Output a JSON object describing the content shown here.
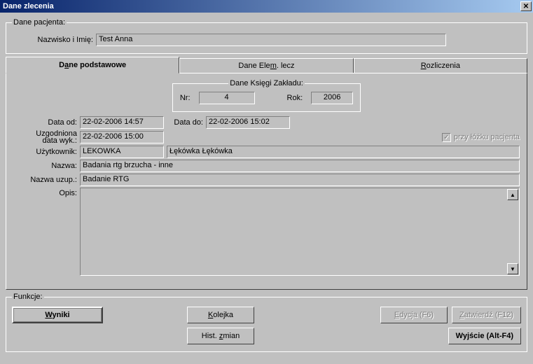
{
  "window": {
    "title": "Dane zlecenia"
  },
  "patient": {
    "legend": "Dane pacjenta:",
    "name_label": "Nazwisko i Imię:",
    "name_value": "Test   Anna"
  },
  "tabs": {
    "basic_pre": "D",
    "basic_ul": "a",
    "basic_post": "ne podstawowe",
    "elem_pre": "Dane Ele",
    "elem_ul": "m",
    "elem_post": ". lecz",
    "rozl_pre": "",
    "rozl_ul": "R",
    "rozl_post": "ozliczenia"
  },
  "ksiega": {
    "legend": "Dane Księgi Zakładu:",
    "nr_label": "Nr:",
    "nr_value": "4",
    "rok_label": "Rok:",
    "rok_value": "2006"
  },
  "fields": {
    "data_od_label": "Data od:",
    "data_od_value": "22-02-2006 14:57",
    "data_do_label": "Data do:",
    "data_do_value": "22-02-2006 15:02",
    "uzg_label_1": "Uzgodniona",
    "uzg_label_2": "data wyk.:",
    "uzg_value": "22-02-2006 15:00",
    "przy_lozku_label": "przy łóżku pacjenta",
    "uzytkownik_label": "Użytkownik:",
    "uzytkownik_code": "LEKOWKA",
    "uzytkownik_name": "Łękówka Łękówka",
    "nazwa_label": "Nazwa:",
    "nazwa_value": "Badania rtg brzucha - inne",
    "nazwa_uzup_label": "Nazwa uzup.:",
    "nazwa_uzup_value": "Badanie RTG",
    "opis_label": "Opis:",
    "opis_value": ""
  },
  "functions": {
    "legend": "Funkcje:",
    "wyniki_ul": "W",
    "wyniki_post": "yniki",
    "kolejka_ul": "K",
    "kolejka_post": "olejka",
    "hist_pre": "Hist. ",
    "hist_ul": "z",
    "hist_post": "mian",
    "edycja_ul": "E",
    "edycja_post": "dycja (F6)",
    "zatwierdz_ul": "Z",
    "zatwierdz_post": "atwierdź (F12)",
    "wyjscie_pre": "Wy",
    "wyjscie_ul": "j",
    "wyjscie_post": "ście (Alt-F4)"
  }
}
